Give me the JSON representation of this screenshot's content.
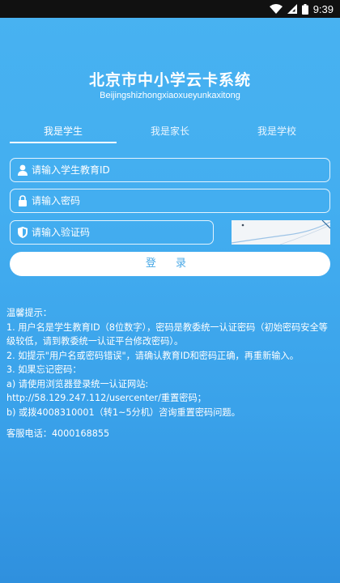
{
  "status_bar": {
    "time": "9:39",
    "icons": [
      "wifi-icon",
      "signal-icon",
      "battery-icon"
    ]
  },
  "header": {
    "title": "北京市中小学云卡系统",
    "subtitle": "Beijingshizhongxiaoxueyunkaxitong"
  },
  "tabs": [
    {
      "label": "我是学生",
      "active": true
    },
    {
      "label": "我是家长",
      "active": false
    },
    {
      "label": "我是学校",
      "active": false
    }
  ],
  "form": {
    "student_id_placeholder": "请输入学生教育ID",
    "password_placeholder": "请输入密码",
    "captcha_placeholder": "请输入验证码",
    "login_label": "登 录"
  },
  "tips": {
    "heading": "温馨提示：",
    "line1": "1. 用户名是学生教育ID（8位数字），密码是教委统一认证密码（初始密码安全等级较低，请到教委统一认证平台修改密码）。",
    "line2": "2. 如提示\"用户名或密码错误\"，请确认教育ID和密码正确，再重新输入。",
    "line3": "3. 如果忘记密码：",
    "line3a": "a) 请使用浏览器登录统一认证网站:",
    "line3a_url": "http://58.129.247.112/usercenter/重置密码；",
    "line3b": "b) 或拨4008310001（转1~5分机）咨询重置密码问题。",
    "service": "客服电话：4000168855"
  },
  "colors": {
    "background_top": "#48b2f1",
    "background_bottom": "#2f90de",
    "login_text": "#4aa9e6"
  }
}
